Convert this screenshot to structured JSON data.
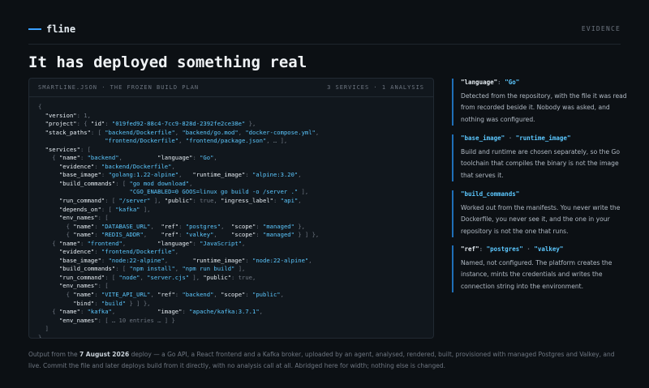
{
  "header": {
    "logo_text": "fline",
    "section_label": "EVIDENCE"
  },
  "title": "It has deployed something real",
  "panel": {
    "label": "SMARTLINE.JSON · THE FROZEN BUILD PLAN",
    "meta": "3 SERVICES · 1 ANALYSIS",
    "code": [
      "{",
      "  \"version\": 1,",
      "  \"project\": { \"id\": \"019fed92-88c4-7cc9-828d-2392fe2ce38e\" },",
      "  \"stack_paths\": [ \"backend/Dockerfile\", \"backend/go.mod\", \"docker-compose.yml\",",
      "                   \"frontend/Dockerfile\", \"frontend/package.json\", … ],",
      "  \"services\": [",
      "    { \"name\": \"backend\",          \"language\": \"Go\",",
      "      \"evidence\": \"backend/Dockerfile\",",
      "      \"base_image\": \"golang:1.22-alpine\",   \"runtime_image\": \"alpine:3.20\",",
      "      \"build_commands\": [ \"go mod download\",",
      "                          \"CGO_ENABLED=0 GOOS=linux go build -o /server .\" ],",
      "      \"run_command\": [ \"/server\" ], \"public\": true, \"ingress_label\": \"api\",",
      "      \"depends_on\": [ \"kafka\" ],",
      "      \"env_names\": [",
      "        { \"name\": \"DATABASE_URL\",  \"ref\": \"postgres\",  \"scope\": \"managed\" },",
      "        { \"name\": \"REDIS_ADDR\",    \"ref\": \"valkey\",    \"scope\": \"managed\" } ] },",
      "    { \"name\": \"frontend\",         \"language\": \"JavaScript\",",
      "      \"evidence\": \"frontend/Dockerfile\",",
      "      \"base_image\": \"node:22-alpine\",       \"runtime_image\": \"node:22-alpine\",",
      "      \"build_commands\": [ \"npm install\", \"npm run build\" ],",
      "      \"run_command\": [ \"node\", \"server.cjs\" ], \"public\": true,",
      "      \"env_names\": [",
      "        { \"name\": \"VITE_API_URL\", \"ref\": \"backend\", \"scope\": \"public\",",
      "          \"bind\": \"build\" } ] },",
      "    { \"name\": \"kafka\",            \"image\": \"apache/kafka:3.7.1\",",
      "      \"env_names\": [ … 10 entries … ] }",
      "  ]",
      "}"
    ]
  },
  "notes": [
    {
      "key": "\"language\": \"Go\"",
      "body": "Detected from the repository, with the file it was read from recorded beside it. Nobody was asked, and nothing was configured."
    },
    {
      "key": "\"base_image\" · \"runtime_image\"",
      "body": "Build and runtime are chosen separately, so the Go toolchain that compiles the binary is not the image that serves it."
    },
    {
      "key": "\"build_commands\"",
      "body": "Worked out from the manifests. You never write the Dockerfile, you never see it, and the one in your repository is not the one that runs."
    },
    {
      "key": "\"ref\": \"postgres\" · \"valkey\"",
      "body": "Named, not configured. The platform creates the instance, mints the credentials and writes the connection string into the environment."
    }
  ],
  "footer": {
    "prefix": "Output from the ",
    "date": "7 August 2026",
    "suffix": " deploy — a Go API, a React frontend and a Kafka broker, uploaded by an agent, analysed, rendered, built, provisioned with managed Postgres and Valkey, and live. Commit the file and later deploys build from it directly, with no analysis call at all. Abridged here for width; nothing else is changed."
  },
  "colors": {
    "accent": "#3aa0ff",
    "string_value": "#5cc8ff",
    "background": "#0c1014",
    "panel": "#11171d"
  }
}
